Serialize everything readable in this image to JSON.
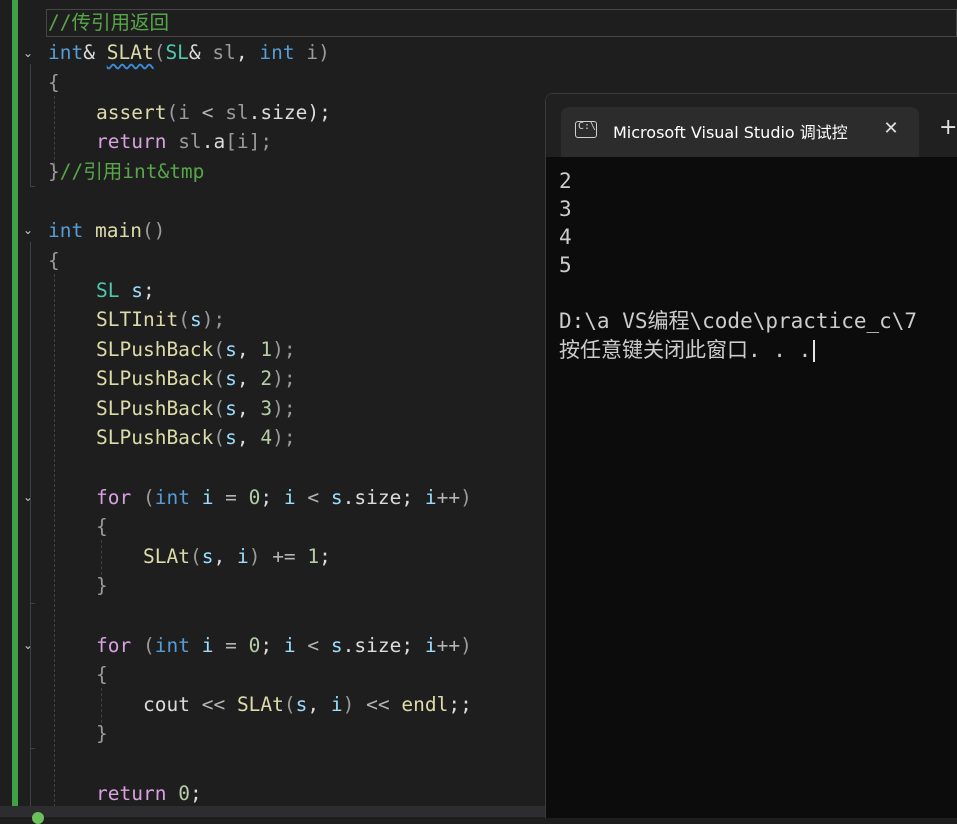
{
  "editor": {
    "lines": {
      "l0_comment": "//传引用返回",
      "l1_kw": "int",
      "l1_amp": "& ",
      "l1_fn": "SLAt",
      "l1_p1": "(",
      "l1_type": "SL",
      "l1_amp2": "& ",
      "l1_var": "sl",
      "l1_comma": ", ",
      "l1_kw2": "int",
      "l1_var2": " i",
      "l1_p2": ")",
      "l2": "{",
      "l3_fn": "assert",
      "l3_p1": "(",
      "l3_var": "i",
      "l3_op": " < ",
      "l3_var2": "sl",
      "l3_dot": ".",
      "l3_mem": "size",
      "l3_p2": ");",
      "l4_kw": "return",
      "l4_var": " sl",
      "l4_dot": ".",
      "l4_mem": "a",
      "l4_idx": "[i];",
      "l5_brace": "}",
      "l5_comment": "//引用int&tmp",
      "l7_kw": "int",
      "l7_fn": " main",
      "l7_par": "()",
      "l8": "{",
      "l9_type": "SL",
      "l9_var": " s",
      "l9_semi": ";",
      "l10_fn": "SLTInit",
      "l10_p1": "(",
      "l10_var": "s",
      "l10_p2": ");",
      "push_fn": "SLPushBack",
      "push_p1": "(",
      "push_var": "s",
      "push_comma": ", ",
      "push_n1": "1",
      "push_n2": "2",
      "push_n3": "3",
      "push_n4": "4",
      "push_p2": ");",
      "for_kw": "for",
      "for_p1": " (",
      "for_int": "int",
      "for_i": " i",
      "for_eq": " = ",
      "for_zero": "0",
      "for_semi": "; ",
      "for_i2": "i",
      "for_lt": " < ",
      "for_s": "s",
      "for_dot": ".",
      "for_size": "size",
      "for_semi2": "; ",
      "for_i3": "i",
      "for_pp": "++",
      "for_p2": ")",
      "brace_open": "{",
      "brace_close": "}",
      "l15_fn": "SLAt",
      "l15_p1": "(",
      "l15_s": "s",
      "l15_comma": ", ",
      "l15_i": "i",
      "l15_p2": ")",
      "l15_op": " += ",
      "l15_num": "1",
      "l15_semi": ";",
      "l20_var": "cout",
      "l20_op": " << ",
      "l20_fn": "SLAt",
      "l20_p1": "(",
      "l20_s": "s",
      "l20_comma": ", ",
      "l20_i": "i",
      "l20_p2": ")",
      "l20_op2": " << ",
      "l20_endl": "endl",
      "l20_semi": ";;",
      "l23_kw": "return",
      "l23_num": " 0",
      "l23_semi": ";"
    },
    "fold_icon": "chevron-down-icon",
    "colors": {
      "change_bar": "#3fa046",
      "keyword": "#569cd6",
      "type": "#4ec9b0",
      "function": "#dcdcaa",
      "variable": "#9cdcfe",
      "comment": "#57a64a",
      "control": "#d8a0df",
      "number": "#b5cea8"
    }
  },
  "console": {
    "tab_title": "Microsoft Visual Studio 调试控",
    "tab_icon": "terminal-icon",
    "close_glyph": "✕",
    "new_tab_glyph": "+",
    "output": [
      "2",
      "3",
      "4",
      "5",
      "",
      "D:\\a VS编程\\code\\practice_c\\7",
      "按任意键关闭此窗口. . ."
    ]
  }
}
